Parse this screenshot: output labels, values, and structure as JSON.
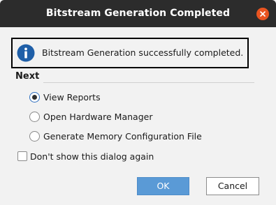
{
  "window": {
    "title": "Bitstream Generation Completed"
  },
  "info": {
    "message": "Bitstream Generation successfully completed."
  },
  "next": {
    "label": "Next",
    "options": [
      {
        "label": "View Reports",
        "selected": true
      },
      {
        "label": "Open Hardware Manager",
        "selected": false
      },
      {
        "label": "Generate Memory Configuration File",
        "selected": false
      }
    ]
  },
  "dont_show": {
    "label": "Don't show this dialog again",
    "checked": false
  },
  "buttons": {
    "ok_label": "OK",
    "cancel_label": "Cancel"
  },
  "colors": {
    "titlebar": "#2c2c2c",
    "close_button": "#e95420",
    "info_icon": "#1f5fa8",
    "ok_button": "#5a9ad6"
  },
  "icons": {
    "close": "close-icon",
    "info": "info-icon"
  }
}
